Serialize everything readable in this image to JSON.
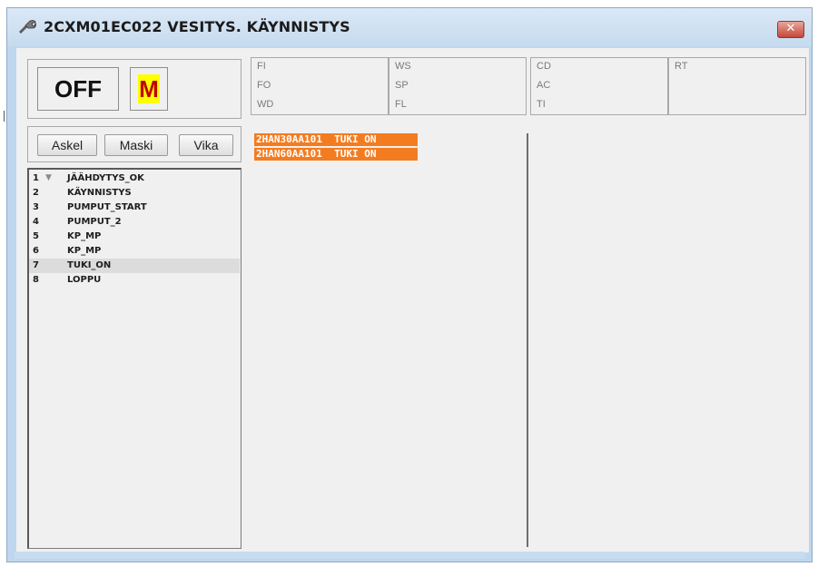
{
  "window": {
    "title": "2CXM01EC022 VESITYS. KÄYNNISTYS",
    "close_label": "✕"
  },
  "mode": {
    "state": "OFF",
    "indicator": "M"
  },
  "codes": {
    "col1": [
      "FI",
      "FO",
      "WD"
    ],
    "col2": [
      "WS",
      "SP",
      "FL"
    ],
    "col3": [
      "CD",
      "AC",
      "TI"
    ],
    "col4": [
      "RT"
    ]
  },
  "buttons": {
    "askel": "Askel",
    "maski": "Maski",
    "vika": "Vika"
  },
  "sequence": {
    "items": [
      {
        "num": "1",
        "label": "JÄÄHDYTYS_OK",
        "arrow": "▼"
      },
      {
        "num": "2",
        "label": "KÄYNNISTYS"
      },
      {
        "num": "3",
        "label": "PUMPUT_START"
      },
      {
        "num": "4",
        "label": "PUMPUT_2"
      },
      {
        "num": "5",
        "label": "KP_MP"
      },
      {
        "num": "6",
        "label": "KP_MP"
      },
      {
        "num": "7",
        "label": "TUKI_ON",
        "selected": true
      },
      {
        "num": "8",
        "label": "LOPPU"
      }
    ]
  },
  "alarms": [
    "2HAN30AA101  TUKI ON",
    "2HAN60AA101  TUKI ON"
  ],
  "colors": {
    "alarm_bg": "#f47c20",
    "indicator_bg": "#ffff00",
    "indicator_fg": "#c00000",
    "titlebar": "#c6dbef"
  }
}
